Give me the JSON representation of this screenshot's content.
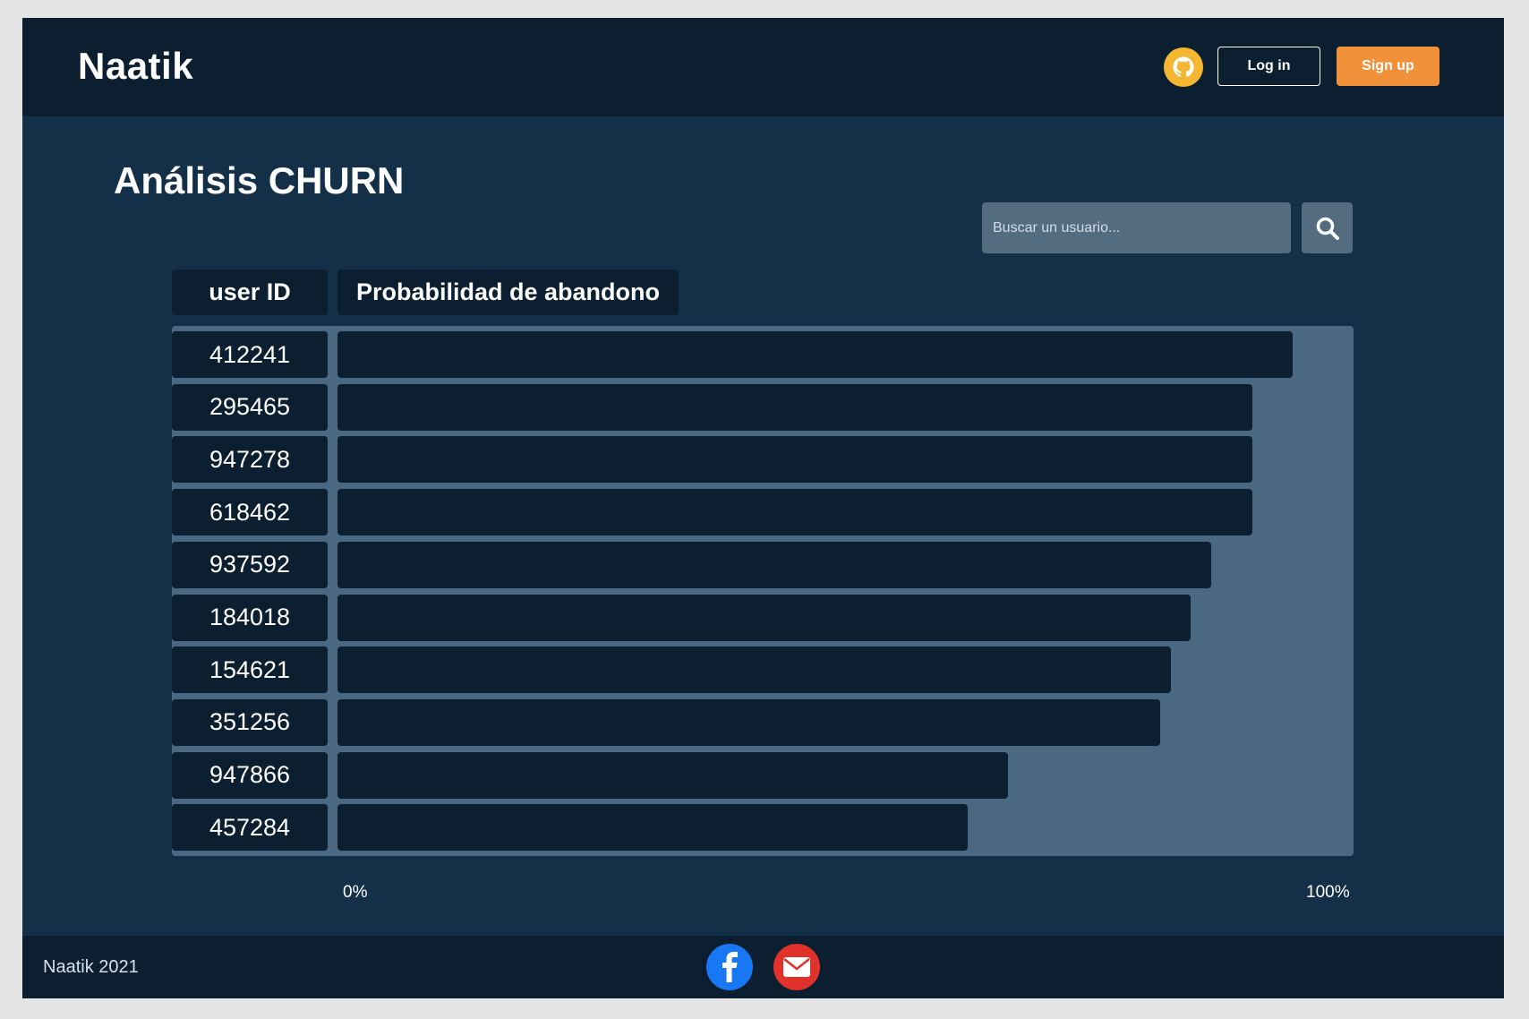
{
  "navbar": {
    "brand": "Naatik",
    "github_icon": "github-icon",
    "login_label": "Log in",
    "signup_label": "Sign up",
    "accent_color": "#f0913a"
  },
  "main": {
    "title": "Análisis CHURN",
    "search": {
      "placeholder": "Buscar un usuario...",
      "value": "",
      "icon": "search-icon"
    },
    "table": {
      "headers": [
        "user ID",
        "Probabilidad de abandono"
      ],
      "axis_min_label": "0%",
      "axis_max_label": "100%"
    }
  },
  "chart_data": {
    "type": "bar",
    "orientation": "horizontal",
    "categories": [
      "412241",
      "295465",
      "947278",
      "618462",
      "937592",
      "184018",
      "154621",
      "351256",
      "947866",
      "457284"
    ],
    "values": [
      94,
      90,
      90,
      90,
      86,
      84,
      82,
      81,
      66,
      62
    ],
    "xlim": [
      0,
      100
    ],
    "xunit": "%"
  },
  "footer": {
    "copyright": "Naatik 2021",
    "social": [
      "facebook-icon",
      "mail-icon"
    ]
  }
}
